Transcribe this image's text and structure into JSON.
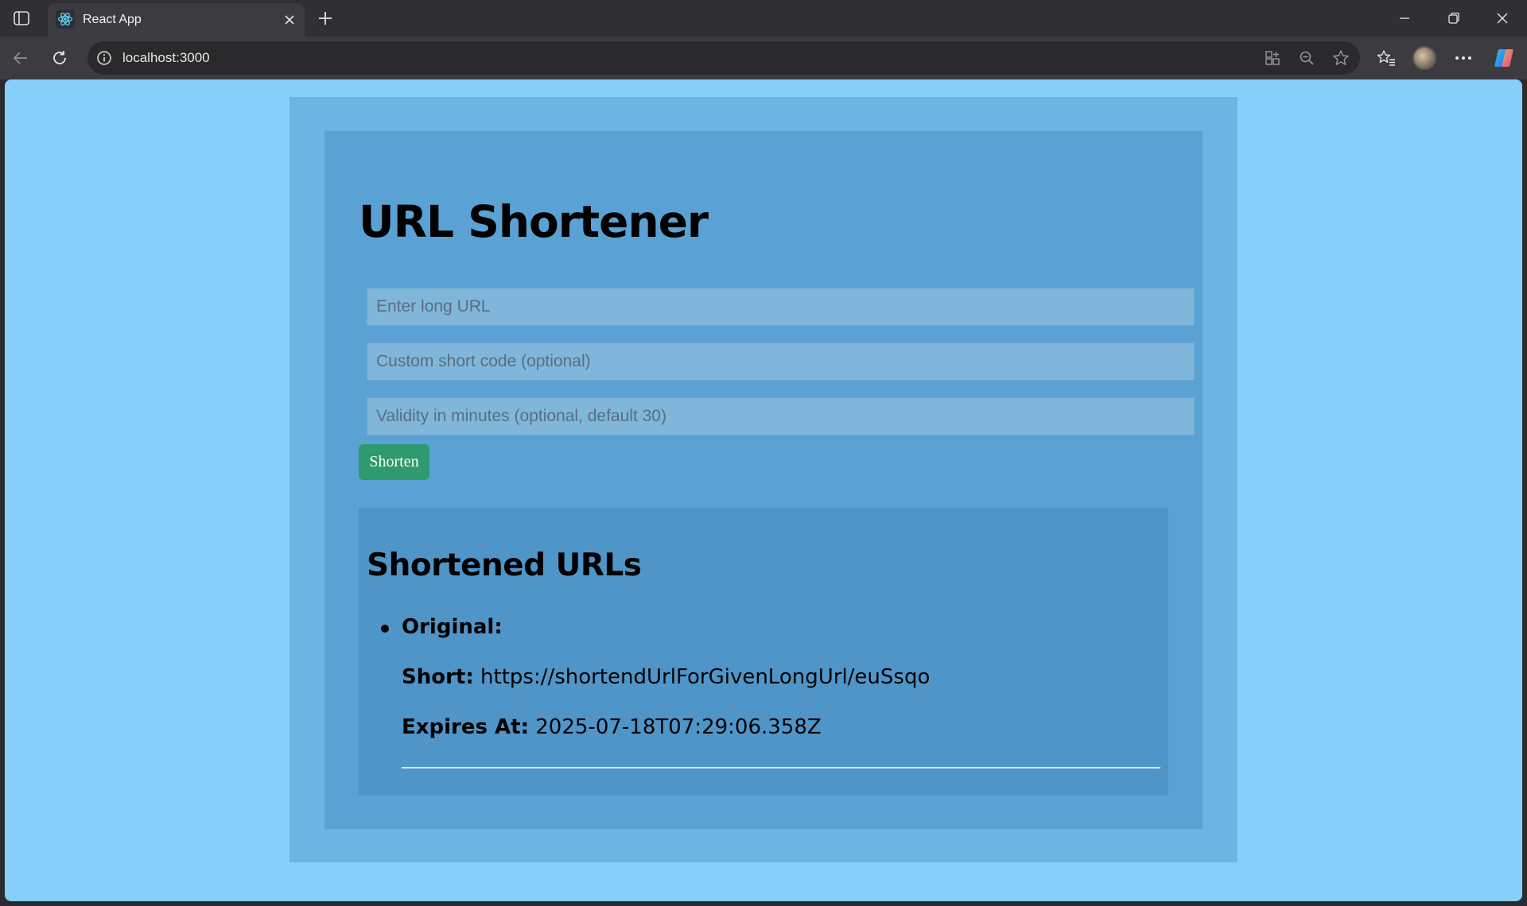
{
  "browser": {
    "tab_title": "React App",
    "url": "localhost:3000"
  },
  "app": {
    "title": "URL Shortener",
    "inputs": {
      "long_url_placeholder": "Enter long URL",
      "custom_code_placeholder": "Custom short code (optional)",
      "validity_placeholder": "Validity in minutes (optional, default 30)"
    },
    "shorten_label": "Shorten",
    "results": {
      "heading": "Shortened URLs",
      "items": [
        {
          "original_label": "Original:",
          "original_value": "",
          "short_label": "Short:",
          "short_value": "https://shortendUrlForGivenLongUrl/euSsqo",
          "expires_label": "Expires At:",
          "expires_value": "2025-07-18T07:29:06.358Z"
        }
      ]
    }
  },
  "colors": {
    "page_bg": "#87cefa",
    "button_bg": "#2e9a6e"
  }
}
